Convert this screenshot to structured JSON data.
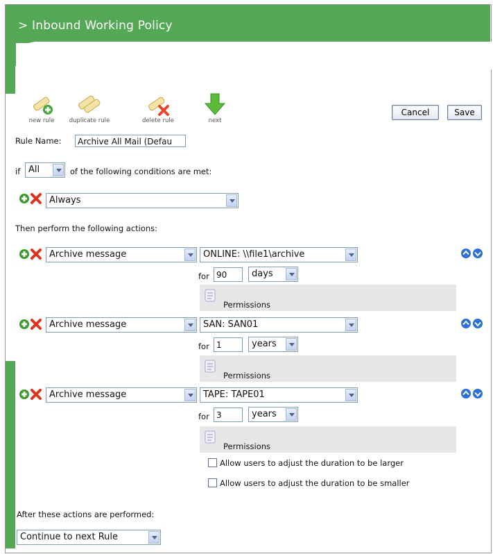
{
  "header": {
    "title": "> Inbound Working Policy"
  },
  "toolbar": {
    "new_rule": "new rule",
    "duplicate_rule": "duplicate rule",
    "delete_rule": "delete rule",
    "next": "next",
    "cancel": "Cancel",
    "save": "Save"
  },
  "rule": {
    "name_label": "Rule Name:",
    "name_value": "Archive All Mail (Defau",
    "if_label": "if",
    "match_value": "All",
    "conditions_text": "of the following conditions are met:",
    "condition_value": "Always",
    "actions_heading": "Then perform the following actions:"
  },
  "actions": [
    {
      "action": "Archive message",
      "target": "ONLINE: \\\\file1\\archive",
      "for_label": "for",
      "duration": "90",
      "unit": "days",
      "permissions": "Permissions"
    },
    {
      "action": "Archive message",
      "target": "SAN: SAN01",
      "for_label": "for",
      "duration": "1",
      "unit": "years",
      "permissions": "Permissions"
    },
    {
      "action": "Archive message",
      "target": "TAPE: TAPE01",
      "for_label": "for",
      "duration": "3",
      "unit": "years",
      "permissions": "Permissions"
    }
  ],
  "options": {
    "allow_larger": "Allow users to adjust the duration to be larger",
    "allow_smaller": "Allow users to adjust the duration to be smaller"
  },
  "after": {
    "heading": "After these actions are performed:",
    "value": "Continue to next Rule"
  },
  "colors": {
    "brand_green": "#54a755",
    "permission_bg": "#e7e7e7",
    "icon_blue": "#2c6fd6"
  }
}
